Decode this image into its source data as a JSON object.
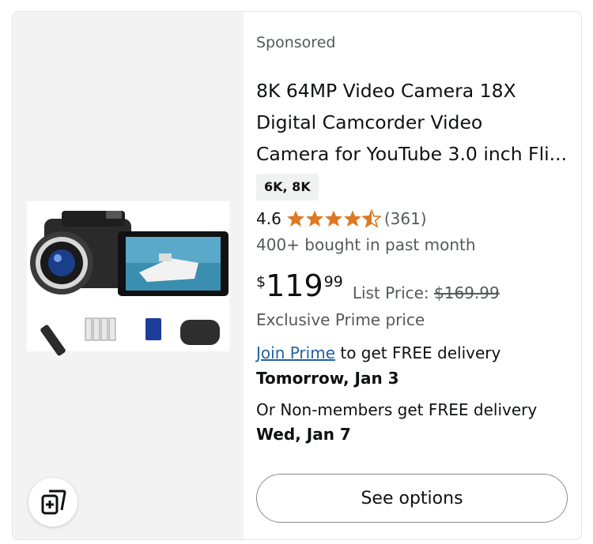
{
  "product": {
    "sponsored_label": "Sponsored",
    "title_lines": [
      "8K 64MP Video Camera 18X",
      "Digital Camcorder Video",
      "Camera for YouTube 3.0 inch Fli..."
    ],
    "resolution_badge": "6K, 8K",
    "rating": "4.6",
    "rating_stars": 4.6,
    "rating_count": "(361)",
    "bought_text": "400+ bought in past month",
    "price": {
      "symbol": "$",
      "whole": "119",
      "fraction": "99"
    },
    "list_price_label": "List Price:",
    "list_price_value": "$169.99",
    "exclusive_text": "Exclusive Prime price",
    "delivery": {
      "join_prime_link": "Join Prime",
      "join_prime_suffix": " to get FREE delivery",
      "prime_date": "Tomorrow, Jan 3",
      "nonmember_text": "Or Non-members get FREE delivery",
      "nonmember_date": "Wed, Jan 7"
    },
    "see_options_label": "See options"
  },
  "icons": {
    "star": "star-icon",
    "half_star": "half-star-icon",
    "compare": "compare-icon"
  },
  "colors": {
    "star": "#de7921",
    "link": "#2162a1",
    "muted": "#565959",
    "badge_bg": "#f0f2f2"
  }
}
